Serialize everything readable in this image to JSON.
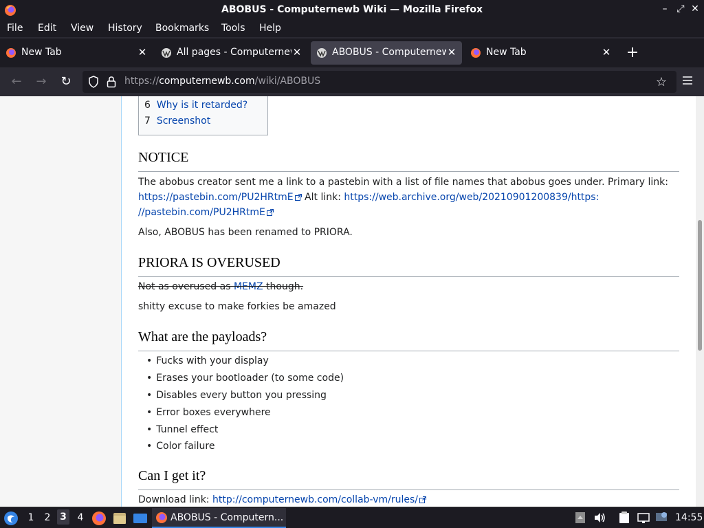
{
  "window": {
    "title": "ABOBUS - Computernewb Wiki — Mozilla Firefox",
    "minimize": "–",
    "maximize": "⤢",
    "close": "✕"
  },
  "menu": [
    "File",
    "Edit",
    "View",
    "History",
    "Bookmarks",
    "Tools",
    "Help"
  ],
  "tabs": [
    {
      "label": "New Tab",
      "icon": "firefox-icon",
      "active": false
    },
    {
      "label": "All pages - Computernewb",
      "icon": "wiki-icon",
      "active": false
    },
    {
      "label": "ABOBUS - Computernewb",
      "icon": "wiki-icon",
      "active": true
    },
    {
      "label": "New Tab",
      "icon": "firefox-icon",
      "active": false
    }
  ],
  "newtab_label": "+",
  "url": {
    "scheme": "https://",
    "host": "computernewb.com",
    "path": "/wiki/ABOBUS"
  },
  "nav": {
    "back": "←",
    "forward": "→",
    "reload": "↻",
    "bookmark": "☆"
  },
  "toc": [
    {
      "num": "6",
      "text": "Why is it retarded?"
    },
    {
      "num": "7",
      "text": "Screenshot"
    }
  ],
  "sections": {
    "notice": {
      "heading": "NOTICE",
      "text1": "The abobus creator sent me a link to a pastebin with a list of file names that abobus goes under. Primary link:",
      "link1": "https://pastebin.com/PU2HRtmE",
      "alt_label": " Alt link: ",
      "link2a": "https://web.archive.org/web/20210901200839/https:",
      "link2b": "//pastebin.com/PU2HRtmE",
      "renamed": "Also, ABOBUS has been renamed to PRIORA."
    },
    "priora": {
      "heading": "PRIORA IS OVERUSED",
      "strike_pre": "Not as overused as ",
      "strike_link": "MEMZ",
      "strike_post": " though.",
      "text": "shitty excuse to make forkies be amazed"
    },
    "payloads": {
      "heading": "What are the payloads?",
      "items": [
        "Fucks with your display",
        "Erases your bootloader (to some code)",
        "Disables every button you pressing",
        "Error boxes everywhere",
        "Tunnel effect",
        "Color failure"
      ]
    },
    "getit": {
      "heading": "Can I get it?",
      "label": "Download link: ",
      "link": "http://computernewb.com/collab-vm/rules/"
    }
  },
  "taskbar": {
    "workspaces": [
      "1",
      "2",
      "3",
      "4"
    ],
    "active_workspace": "3",
    "window_label": "ABOBUS - Computern...",
    "clock": "14:55"
  },
  "colors": {
    "chrome": "#1c1b22",
    "toolbar": "#2b2a33",
    "active_tab": "#42414d",
    "link": "#0645ad",
    "firefox_orange": "#ff7139"
  }
}
